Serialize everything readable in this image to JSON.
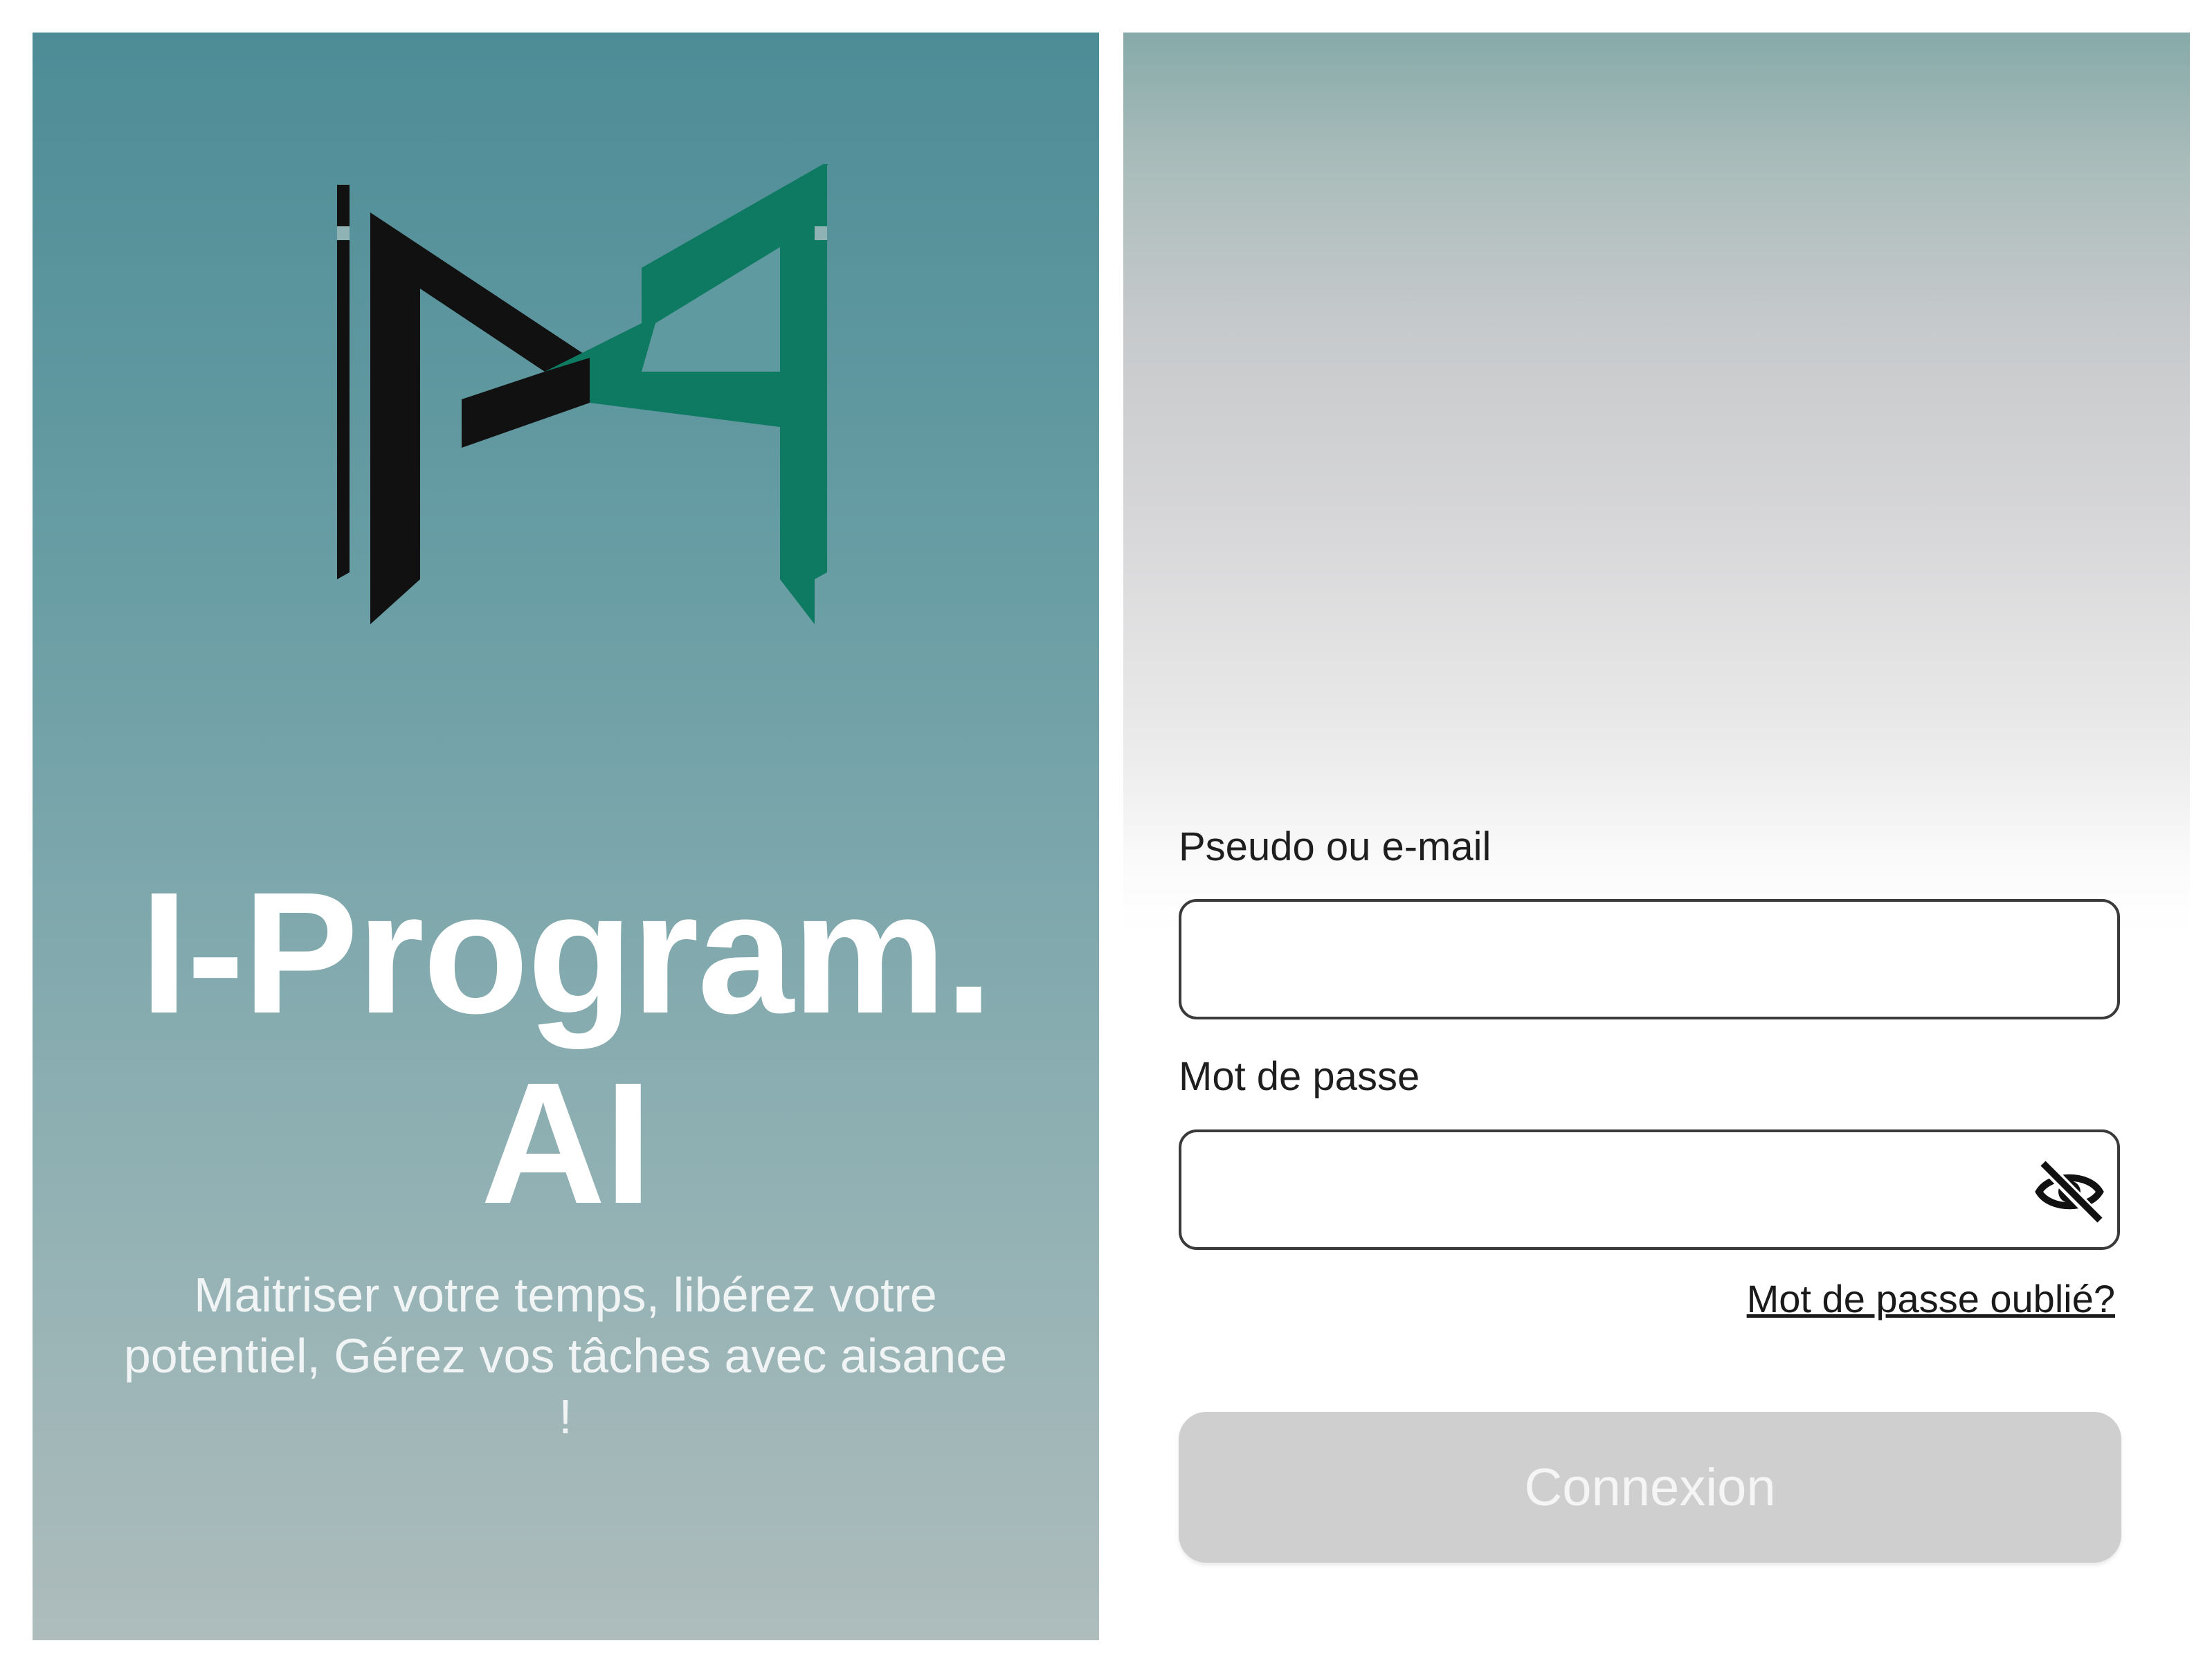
{
  "splash": {
    "logo_icon": "ipai-monogram-logo",
    "title_line_1": "I-Program.",
    "title_line_2": "AI",
    "tagline": "Maitriser votre temps, libérez votre potentiel, Gérez vos tâches avec aisance !",
    "colors": {
      "gradient_top": "#4d8c96",
      "gradient_bottom": "#aebcbc",
      "logo_dark": "#111111",
      "logo_green": "#0f7a62"
    }
  },
  "login": {
    "username_label": "Pseudo ou e-mail",
    "username_value": "",
    "password_label": "Mot de passe",
    "password_value": "",
    "password_toggle_icon": "eye-off-icon",
    "forgot_password": "Mot de passe oublié?",
    "submit_label": "Connexion",
    "submit_state": "disabled",
    "colors": {
      "button_bg": "#cfcfcf",
      "button_text": "#f5f5f5"
    }
  }
}
